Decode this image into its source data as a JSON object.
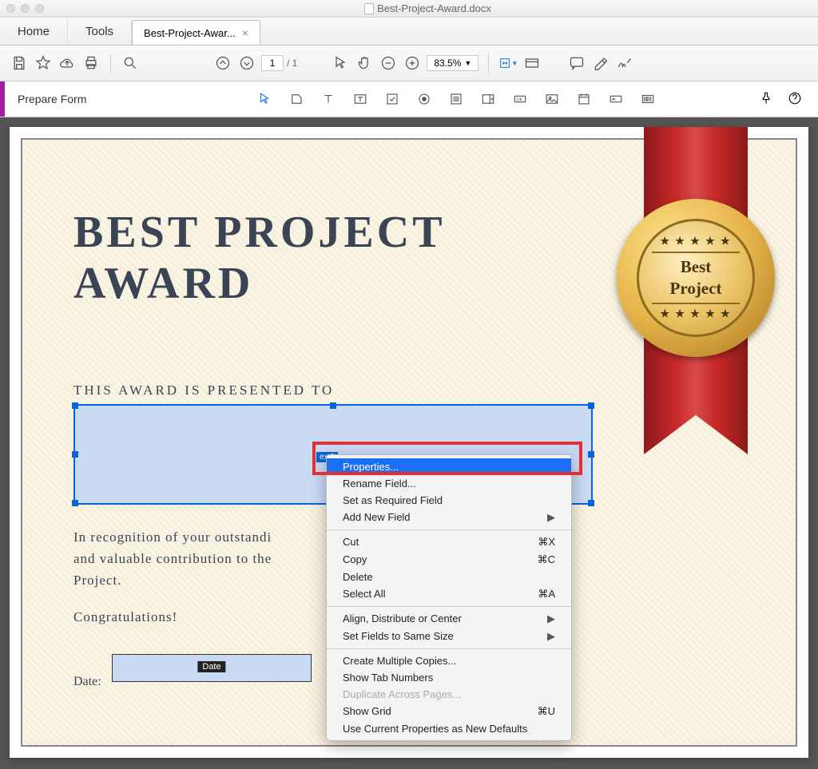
{
  "window": {
    "title": "Best-Project-Award.docx"
  },
  "tabs": {
    "home": "Home",
    "tools": "Tools",
    "doc": "Best-Project-Awar..."
  },
  "toolbar": {
    "page_current": "1",
    "page_total": "/  1",
    "zoom": "83.5%"
  },
  "formbar": {
    "label": "Prepare Form"
  },
  "certificate": {
    "title_line1": "BEST PROJECT",
    "title_line2": "AWARD",
    "subheading": "THIS AWARD IS PRESENTED TO",
    "body_line1": "In recognition of your outstandi",
    "body_line2": "and valuable contribution to the",
    "body_line3": "Project.",
    "congrats": "Congratulations!",
    "date_label": "Date:",
    "field_tag": "ext3",
    "date_tag": "Date",
    "seal_line1": "Best",
    "seal_line2": "Project"
  },
  "context_menu": {
    "properties": "Properties...",
    "rename": "Rename Field...",
    "required": "Set as Required Field",
    "addnew": "Add New Field",
    "cut": "Cut",
    "cut_sc": "⌘X",
    "copy": "Copy",
    "copy_sc": "⌘C",
    "delete": "Delete",
    "selectall": "Select All",
    "selectall_sc": "⌘A",
    "align": "Align, Distribute or Center",
    "samesize": "Set Fields to Same Size",
    "multicopy": "Create Multiple Copies...",
    "tabnum": "Show Tab Numbers",
    "dup": "Duplicate Across Pages...",
    "grid": "Show Grid",
    "grid_sc": "⌘U",
    "defaults": "Use Current Properties as New Defaults"
  }
}
